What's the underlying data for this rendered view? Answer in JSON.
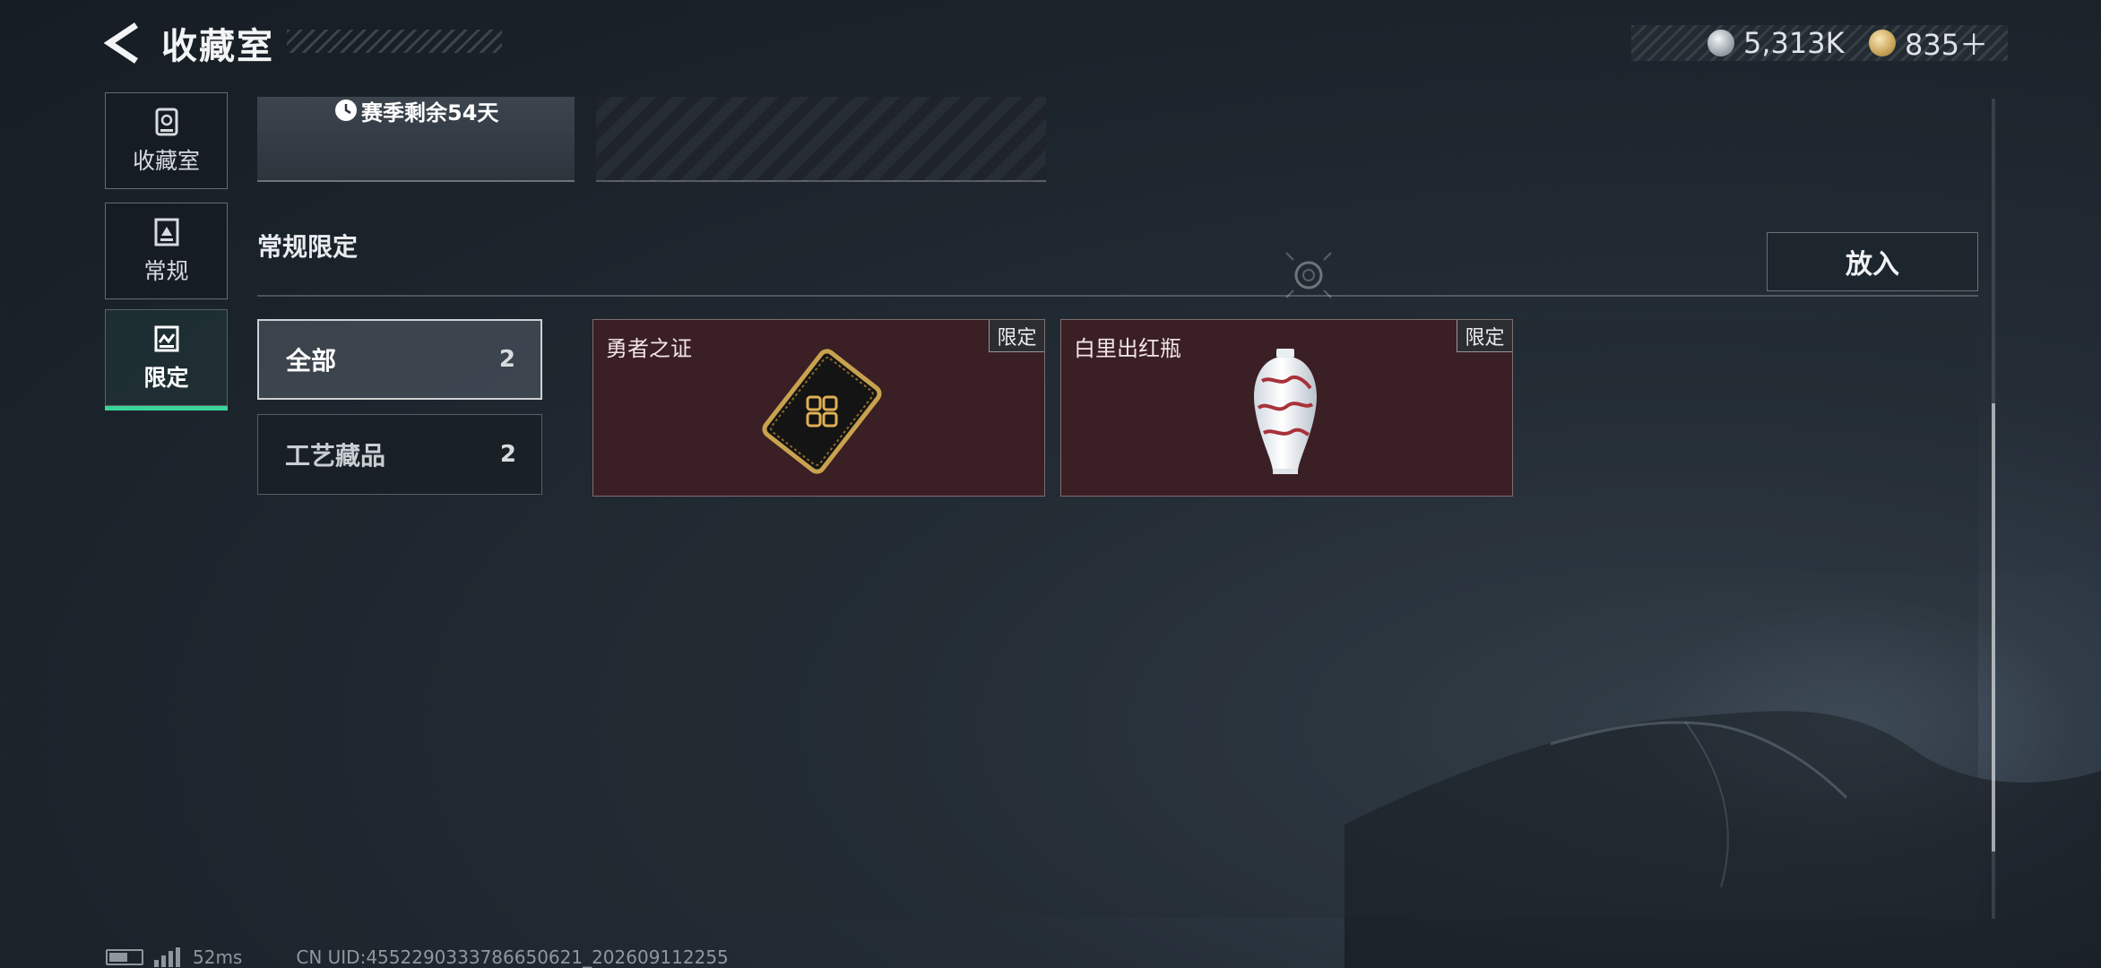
{
  "header": {
    "title": "收藏室",
    "currencies": [
      {
        "icon": "silver-coin-icon",
        "value": "5,313K"
      },
      {
        "icon": "gold-coin-icon",
        "value": "835＋"
      }
    ]
  },
  "sidebar": {
    "items": [
      {
        "label": "收藏室",
        "icon": "collection-room-icon",
        "active": false
      },
      {
        "label": "常规",
        "icon": "regular-icon",
        "active": false
      },
      {
        "label": "限定",
        "icon": "limited-icon",
        "active": true
      }
    ]
  },
  "banner": {
    "season_time": "赛季剩余54天"
  },
  "section": {
    "title": "常规限定",
    "put_in_label": "放入"
  },
  "filters": [
    {
      "label": "全部",
      "count": "2",
      "selected": true
    },
    {
      "label": "工艺藏品",
      "count": "2",
      "selected": false
    }
  ],
  "items": [
    {
      "name": "勇者之证",
      "badge": "限定",
      "art": "card-token-icon"
    },
    {
      "name": "白里出红瓶",
      "badge": "限定",
      "art": "porcelain-vase-icon"
    }
  ],
  "footer": {
    "ping": "52ms",
    "uid": "CN UID:4552290333786650621_202609112255"
  },
  "colors": {
    "accent": "#3ad59a",
    "card_bg": "#3a1f24"
  }
}
